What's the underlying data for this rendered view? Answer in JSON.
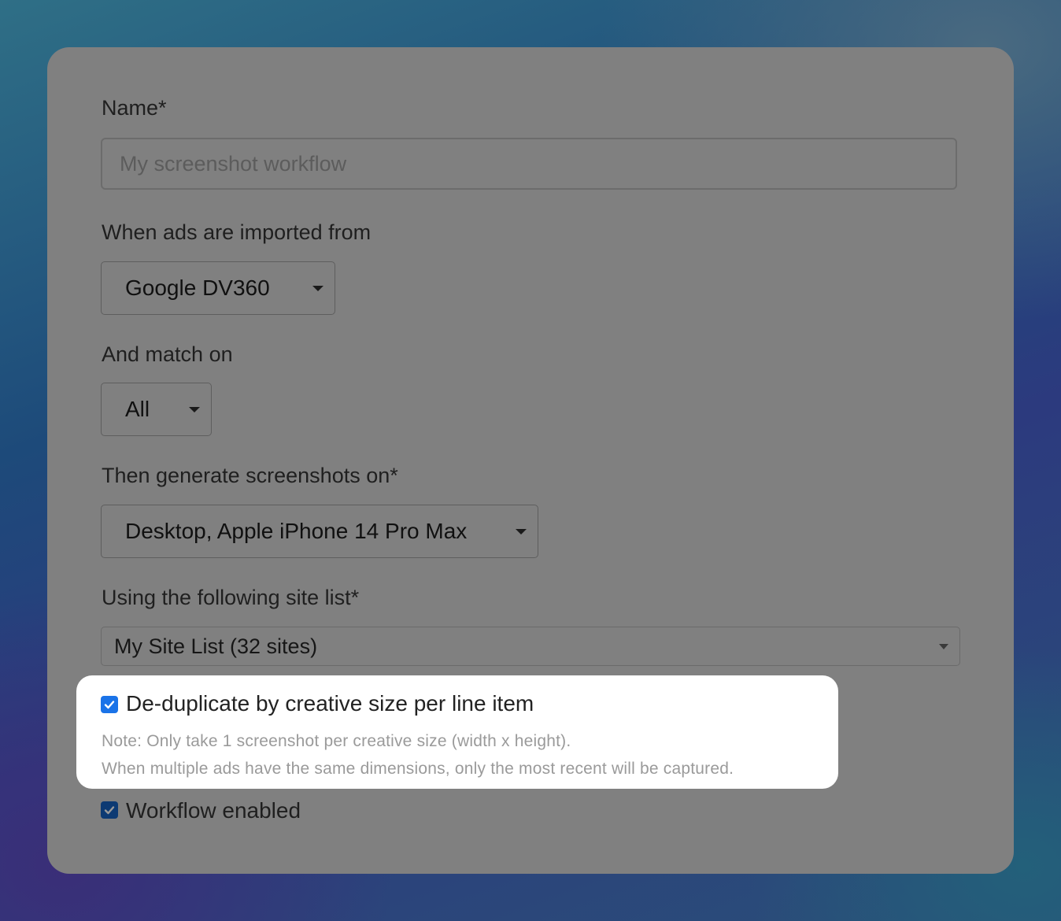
{
  "form": {
    "name": {
      "label": "Name*",
      "value": "",
      "placeholder": "My screenshot workflow"
    },
    "import_source": {
      "label": "When ads are imported from",
      "selected": "Google DV360"
    },
    "match_on": {
      "label": "And match on",
      "selected": "All"
    },
    "devices": {
      "label": "Then generate screenshots on*",
      "selected": "Desktop, Apple iPhone 14 Pro Max"
    },
    "site_list": {
      "label": "Using the following site list*",
      "selected": "My Site List (32 sites)"
    },
    "deduplicate": {
      "label": "De-duplicate by creative size per line item",
      "checked": true,
      "note_line1": "Note: Only take 1 screenshot per creative size (width x height).",
      "note_line2": "When multiple ads have the same dimensions, only the most recent will be captured."
    },
    "workflow_enabled": {
      "label": "Workflow enabled",
      "checked": true
    }
  },
  "icons": {
    "dropdown": "caret-down-icon",
    "checkbox": "checkmark-icon"
  },
  "colors": {
    "checkbox_active": "#1a73e8",
    "checkbox_dimmed": "#0d3a73",
    "overlay_card": "#808080",
    "highlight": "#ffffff"
  }
}
